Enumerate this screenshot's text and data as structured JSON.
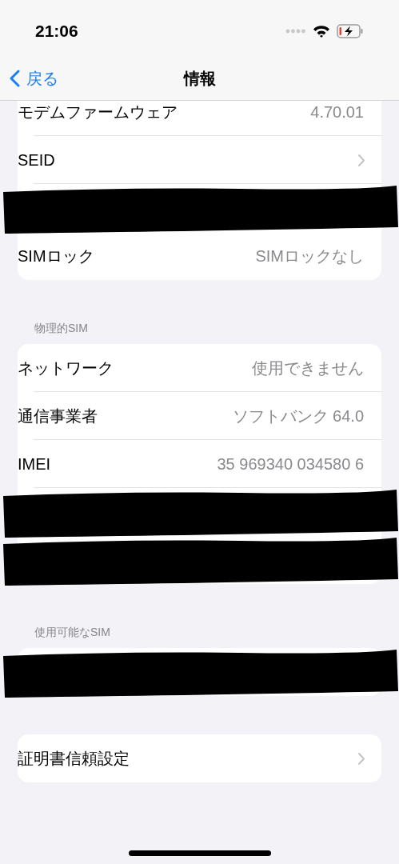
{
  "status_bar": {
    "time": "21:06"
  },
  "nav": {
    "back": "戻る",
    "title": "情報"
  },
  "groups": [
    {
      "rows": [
        {
          "kind": "value",
          "label": "モデムファームウェア",
          "value": "4.70.01"
        },
        {
          "kind": "link",
          "label": "SEID"
        },
        {
          "kind": "redacted"
        },
        {
          "kind": "value",
          "label": "SIMロック",
          "value": "SIMロックなし"
        }
      ]
    },
    {
      "header": "物理的SIM",
      "rows": [
        {
          "kind": "value",
          "label": "ネットワーク",
          "value": "使用できません"
        },
        {
          "kind": "value",
          "label": "通信事業者",
          "value": "ソフトバンク 64.0"
        },
        {
          "kind": "value",
          "label": "IMEI",
          "value": "35 969340 034580 6"
        },
        {
          "kind": "redacted"
        },
        {
          "kind": "redacted"
        }
      ]
    },
    {
      "header": "使用可能なSIM",
      "rows": [
        {
          "kind": "redacted"
        }
      ]
    },
    {
      "rows": [
        {
          "kind": "link",
          "label": "証明書信頼設定"
        }
      ]
    }
  ]
}
